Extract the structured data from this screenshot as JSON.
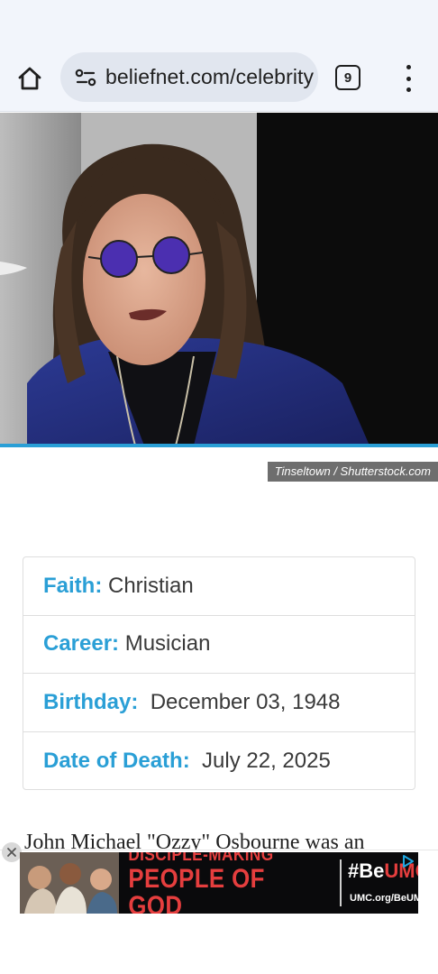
{
  "browser": {
    "url": "beliefnet.com/celebrity",
    "tab_count": "9",
    "home_icon": "home-icon",
    "site_settings_icon": "tune-icon",
    "menu_icon": "more-vert-icon"
  },
  "hero": {
    "photo_credit": "Tinseltown / Shutterstock.com",
    "accent_color": "#2a9fd6"
  },
  "info": {
    "rows": [
      {
        "label": "Faith:",
        "value": "Christian"
      },
      {
        "label": "Career:",
        "value": "Musician"
      },
      {
        "label": "Birthday:",
        "value": "December 03, 1948"
      },
      {
        "label": "Date of Death:",
        "value": "July 22, 2025"
      }
    ]
  },
  "article": {
    "first_line": "John Michael \"Ozzy\" Osbourne was an"
  },
  "ad": {
    "headline_line1": "DISCIPLE-MAKING",
    "headline_line2": "PEOPLE OF GOD",
    "brand_prefix": "#Be",
    "brand_suffix": "UMC",
    "url": "UMC.org/BeUMC",
    "close_icon": "close-icon",
    "adchoices_icon": "adchoices-icon"
  }
}
